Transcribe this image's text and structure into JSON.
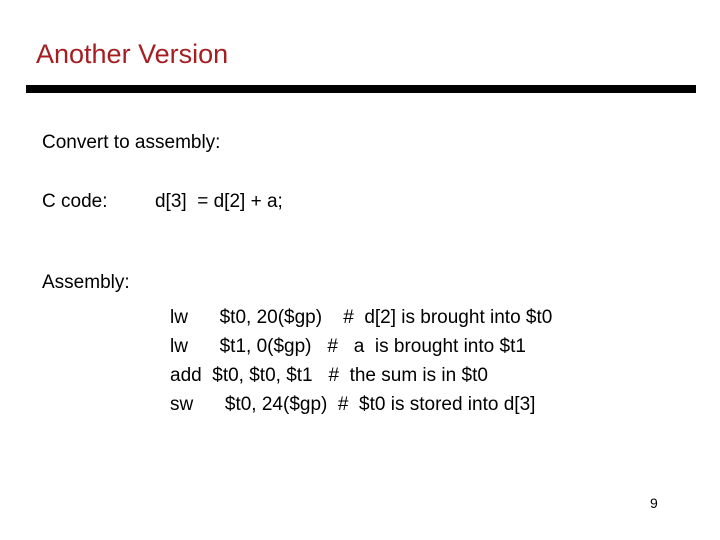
{
  "slide": {
    "title": "Another Version",
    "title_color": "#A41E22",
    "rule_color": "#000000",
    "page_number": "9",
    "body": {
      "prompt": "Convert to assembly:",
      "c_code_label": "C code:",
      "c_code_value": "d[3]  = d[2] + a;",
      "c_code_line": "C code:         d[3]  = d[2] + a;",
      "assembly_label": "Assembly:"
    },
    "assembly": {
      "lines": [
        {
          "mnemonic": "lw",
          "operands": "$t0, 20($gp)",
          "comment": "#  d[2] is brought into $t0",
          "text": "lw      $t0, 20($gp)    #  d[2] is brought into $t0"
        },
        {
          "mnemonic": "lw",
          "operands": "$t1, 0($gp)",
          "comment": "#   a  is brought into $t1",
          "text": "lw      $t1, 0($gp)   #   a  is brought into $t1"
        },
        {
          "mnemonic": "add",
          "operands": "$t0, $t0, $t1",
          "comment": "#  the sum is in $t0",
          "text": "add  $t0, $t0, $t1   #  the sum is in $t0"
        },
        {
          "mnemonic": "sw",
          "operands": "$t0, 24($gp)",
          "comment": "#  $t0 is stored into d[3]",
          "text": "sw      $t0, 24($gp)  #  $t0 is stored into d[3]"
        }
      ],
      "block_text": "lw      $t0, 20($gp)    #  d[2] is brought into $t0\nlw      $t1, 0($gp)   #   a  is brought into $t1\nadd  $t0, $t0, $t1   #  the sum is in $t0\nsw      $t0, 24($gp)  #  $t0 is stored into d[3]"
    }
  }
}
